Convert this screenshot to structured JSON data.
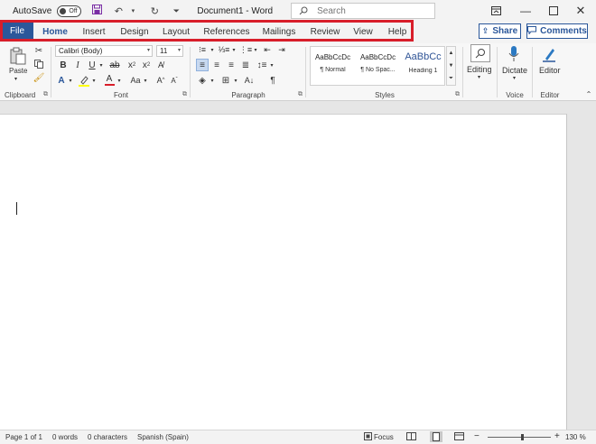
{
  "titlebar": {
    "autosave_label": "AutoSave",
    "autosave_state": "Off",
    "doc_title": "Document1 - Word",
    "search_placeholder": "Search"
  },
  "tabs": [
    "File",
    "Home",
    "Insert",
    "Design",
    "Layout",
    "References",
    "Mailings",
    "Review",
    "View",
    "Help"
  ],
  "active_tab": "Home",
  "header_buttons": {
    "share": "Share",
    "comments": "Comments"
  },
  "ribbon": {
    "clipboard": {
      "paste": "Paste",
      "label": "Clipboard"
    },
    "font": {
      "name": "Calibri (Body)",
      "size": "11",
      "label": "Font"
    },
    "paragraph": {
      "label": "Paragraph"
    },
    "styles": {
      "label": "Styles",
      "items": [
        {
          "sample": "AaBbCcDc",
          "name": "¶ Normal"
        },
        {
          "sample": "AaBbCcDc",
          "name": "¶ No Spac..."
        },
        {
          "sample": "AaBbCc",
          "name": "Heading 1"
        }
      ]
    },
    "editing": {
      "label": "Editing"
    },
    "voice": {
      "dictate": "Dictate",
      "label": "Voice"
    },
    "editor": {
      "button": "Editor",
      "label": "Editor"
    }
  },
  "status": {
    "page": "Page 1 of 1",
    "words": "0 words",
    "characters": "0 characters",
    "language": "Spanish (Spain)",
    "focus": "Focus",
    "zoom": "130 %",
    "zoom_value": 130
  },
  "colors": {
    "accent": "#2b579a",
    "highlight_box": "#d81e2a",
    "save_icon": "#7a2ea5"
  }
}
